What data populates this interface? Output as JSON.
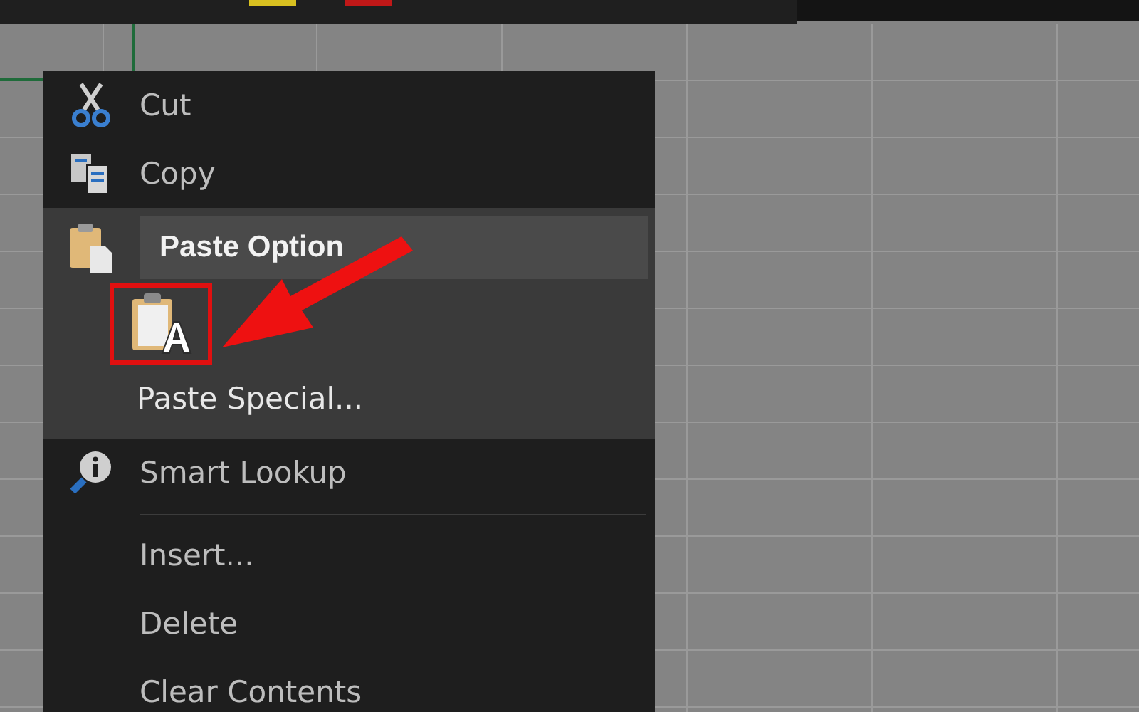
{
  "context_menu": {
    "items": [
      {
        "kind": "command",
        "label": "Cut"
      },
      {
        "kind": "command",
        "label": "Copy"
      },
      {
        "kind": "paste_header",
        "label": "Paste Option"
      },
      {
        "kind": "paste_icons"
      },
      {
        "kind": "paste_command",
        "label": "Paste Special..."
      },
      {
        "kind": "command",
        "label": "Smart Lookup"
      },
      {
        "kind": "separator"
      },
      {
        "kind": "command",
        "label": "Insert..."
      },
      {
        "kind": "command",
        "label": "Delete"
      },
      {
        "kind": "command",
        "label": "Clear Contents"
      }
    ]
  }
}
